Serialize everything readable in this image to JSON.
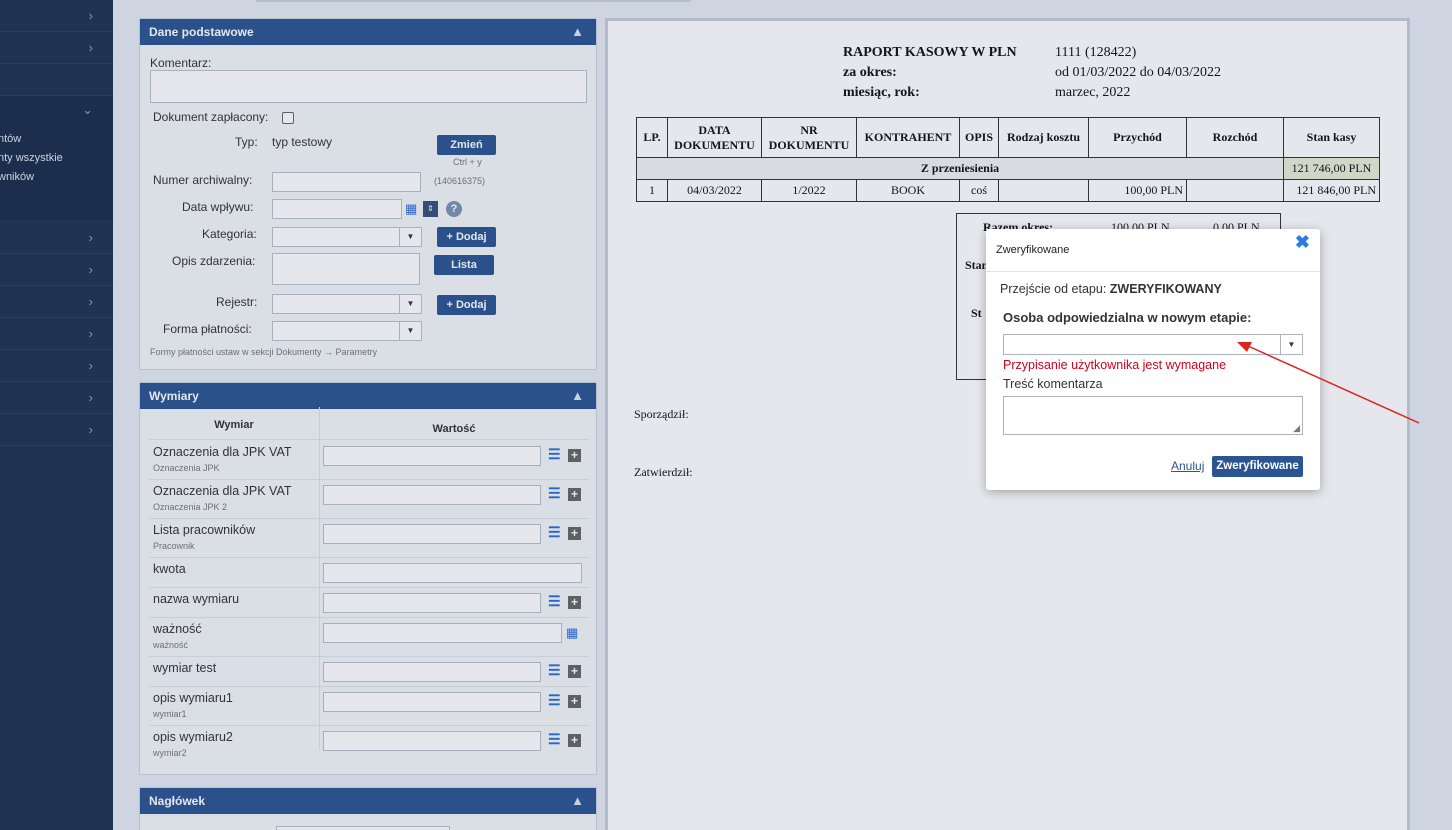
{
  "sidebar": {
    "items": [
      {
        "chevron": "›"
      },
      {
        "chevron": "›"
      },
      {
        "chevron": "⌄"
      },
      {
        "chevron": "›"
      },
      {
        "chevron": "›"
      },
      {
        "chevron": "›"
      },
      {
        "chevron": "›"
      },
      {
        "chevron": "›"
      },
      {
        "chevron": "›"
      },
      {
        "chevron": "›"
      }
    ],
    "sub_items": [
      "ntów",
      "nty wszystkie",
      "wników"
    ]
  },
  "basic": {
    "title": "Dane podstawowe",
    "toggle": "▲",
    "comment_label": "Komentarz:",
    "paid_label": "Dokument zapłacony:",
    "type_label": "Typ:",
    "type_value": "typ testowy",
    "change_button": "Zmień",
    "change_shortcut": "Ctrl + y",
    "archive_label": "Numer archiwalny:",
    "archive_id": "(140616375)",
    "inflow_label": "Data wpływu:",
    "category_label": "Kategoria:",
    "add_button": "+ Dodaj",
    "event_label": "Opis zdarzenia:",
    "list_button": "Lista",
    "register_label": "Rejestr:",
    "payment_label": "Forma płatności:",
    "hint": "Formy płatności ustaw w sekcji Dokumenty → Parametry"
  },
  "dims": {
    "title": "Wymiary",
    "toggle": "▲",
    "col_name": "Wymiar",
    "col_value": "Wartość",
    "rows": [
      {
        "name": "Oznaczenia dla JPK VAT",
        "sub": "Oznaczenia JPK"
      },
      {
        "name": "Oznaczenia dla JPK VAT",
        "sub": "Oznaczenia JPK 2"
      },
      {
        "name": "Lista pracowników",
        "sub": "Pracownik"
      },
      {
        "name": "kwota",
        "sub": ""
      },
      {
        "name": "nazwa wymiaru",
        "sub": ""
      },
      {
        "name": "ważność",
        "sub": "ważność"
      },
      {
        "name": "wymiar test",
        "sub": ""
      },
      {
        "name": "opis wymiaru1",
        "sub": "wymiar1"
      },
      {
        "name": "opis wymiaru2",
        "sub": "wymiar2"
      }
    ]
  },
  "header_panel": {
    "title": "Nagłówek",
    "toggle": "▲"
  },
  "report": {
    "title": "RAPORT KASOWY W PLN",
    "number": "1111 (128422)",
    "period_label": "za okres:",
    "period_value": "od 01/03/2022 do 04/03/2022",
    "month_label": "miesiąc, rok:",
    "month_value": "marzec, 2022",
    "columns": [
      "LP.",
      "DATA DOKUMENTU",
      "NR DOKUMENTU",
      "KONTRAHENT",
      "OPIS",
      "Rodzaj kosztu",
      "Przychód",
      "Rozchód",
      "Stan kasy"
    ],
    "carry_label": "Z przeniesienia",
    "carry_value": "121 746,00 PLN",
    "row": {
      "lp": "1",
      "date": "04/03/2022",
      "nr": "1/2022",
      "contractor": "BOOK",
      "desc": "coś",
      "cost": "",
      "income": "100,00 PLN",
      "expense": "",
      "balance": "121 846,00 PLN"
    },
    "summary_label": "Razem okres:",
    "summary_income": "100,00 PLN",
    "summary_expense": "0,00 PLN",
    "sum_partial": [
      "Stan",
      "St"
    ],
    "prepared_label": "Sporządził:",
    "approved_label": "Zatwierdził:"
  },
  "dialog": {
    "title": "Zweryfikowane",
    "close": "✖",
    "transition_label": "Przejście od etapu:",
    "transition_value": "ZWERYFIKOWANY",
    "person_label": "Osoba odpowiedzialna w nowym etapie:",
    "error": "Przypisanie użytkownika jest wymagane",
    "comment_label": "Treść komentarza",
    "cancel": "Anuluj",
    "confirm": "Zweryfikowane",
    "error_color": "#d0021b"
  },
  "annotation": {
    "color": "#e0221e"
  }
}
